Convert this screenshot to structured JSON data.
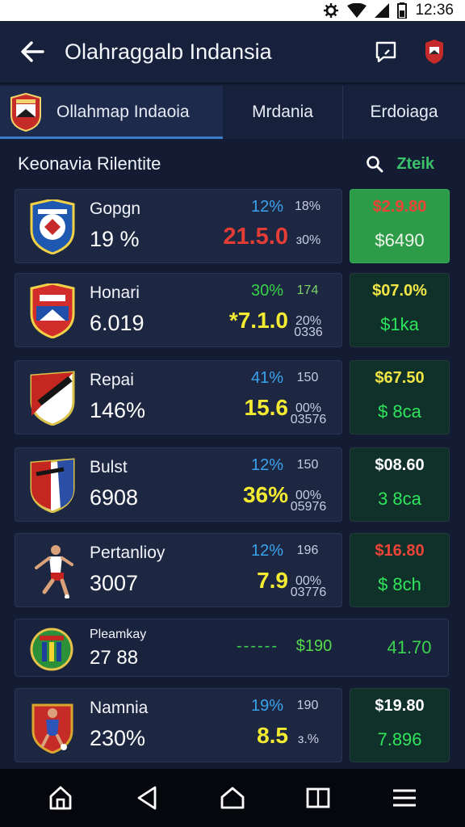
{
  "status_bar": {
    "time": "12:36"
  },
  "app_bar": {
    "title": "Olahraggalɒ Indansia"
  },
  "tabs": [
    {
      "label": "Ollahmap Indaoia"
    },
    {
      "label": "Mrdania"
    },
    {
      "label": "Erdoiaga"
    }
  ],
  "section": {
    "title": "Keonavia Rilentite",
    "search_label": "Zteik"
  },
  "rows": [
    {
      "name": "Gopgn",
      "value": "19 %",
      "pct": "12%",
      "small": "18%",
      "score": "21.5.0",
      "small2": "ɜ0%",
      "price_top": "$2.9.80",
      "price_bottom": "$6490"
    },
    {
      "name": "Honari",
      "value": "6.019",
      "pct": "30%",
      "small": "174",
      "score": "*7.1.0",
      "small2": "20%\n0336",
      "price_top": "$07.0%",
      "price_bottom": "$1ka"
    },
    {
      "name": "Repai",
      "value": "146%",
      "pct": "41%",
      "small": "150",
      "score": "15.6",
      "small2": "00%\n03576",
      "price_top": "$67.50",
      "price_bottom": "$ 8ca"
    },
    {
      "name": "Bulst",
      "value": "6908",
      "pct": "12%",
      "small": "150",
      "score": "36%",
      "small2": "00%\n05976",
      "price_top": "$08.60",
      "price_bottom": "3 8ca"
    },
    {
      "name": "Pertanlioy",
      "value": "3007",
      "pct": "12%",
      "small": "196",
      "score": "7.9",
      "small2": "00%\n03776",
      "price_top": "$16.80",
      "price_bottom": "$ 8ch"
    },
    {
      "name": "Namnia",
      "value": "230%",
      "pct": "19%",
      "small": "190",
      "score": "8.5",
      "small2": "ɜ.%",
      "price_top": "$19.80",
      "price_bottom": "7.896"
    }
  ],
  "wide_row": {
    "name": "Pleamkay",
    "value": "27 88",
    "dash": "------",
    "mid": "$190",
    "right": "41.70"
  },
  "colors": {
    "accent": "#3d7cc9",
    "highlight_green": "#2c9c48",
    "background": "#131c33"
  },
  "icons": [
    "arrow-left-icon",
    "message-icon",
    "club-crest-icon",
    "search-icon",
    "home-icon",
    "back-triangle-icon",
    "home-outline-icon",
    "recents-icon",
    "menu-icon"
  ]
}
